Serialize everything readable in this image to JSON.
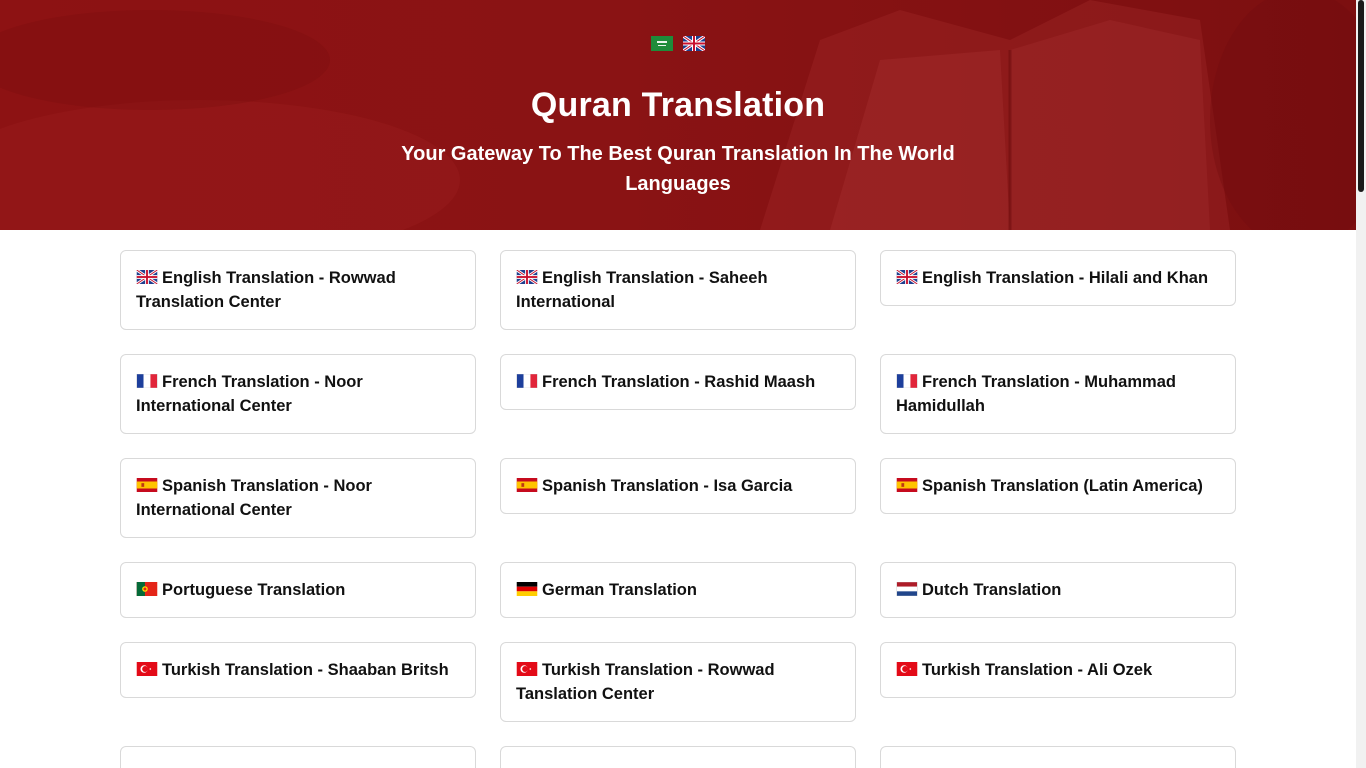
{
  "hero": {
    "title": "Quran Translation",
    "subtitle": "Your Gateway To The Best Quran Translation In The World Languages",
    "languages": [
      {
        "icon": "saudi-flag-icon",
        "code": "ar"
      },
      {
        "icon": "uk-flag-icon",
        "code": "en"
      }
    ],
    "colors": {
      "background": "#8a1314",
      "text": "#ffffff"
    }
  },
  "translations": [
    {
      "label": "English Translation - Rowwad Translation Center",
      "flag": "uk-flag-icon"
    },
    {
      "label": "English Translation - Saheeh International",
      "flag": "uk-flag-icon"
    },
    {
      "label": "English Translation - Hilali and Khan",
      "flag": "uk-flag-icon"
    },
    {
      "label": "French Translation - Noor International Center",
      "flag": "france-flag-icon"
    },
    {
      "label": "French Translation - Rashid Maash",
      "flag": "france-flag-icon"
    },
    {
      "label": "French Translation - Muhammad Hamidullah",
      "flag": "france-flag-icon"
    },
    {
      "label": "Spanish Translation - Noor International Center",
      "flag": "spain-flag-icon"
    },
    {
      "label": "Spanish Translation - Isa Garcia",
      "flag": "spain-flag-icon"
    },
    {
      "label": "Spanish Translation (Latin America)",
      "flag": "spain-flag-icon"
    },
    {
      "label": "Portuguese Translation",
      "flag": "portugal-flag-icon"
    },
    {
      "label": "German Translation",
      "flag": "germany-flag-icon"
    },
    {
      "label": "Dutch Translation",
      "flag": "netherlands-flag-icon"
    },
    {
      "label": "Turkish Translation - Shaaban Britsh",
      "flag": "turkey-flag-icon"
    },
    {
      "label": "Turkish Translation - Rowwad Tanslation Center",
      "flag": "turkey-flag-icon"
    },
    {
      "label": "Turkish Translation - Ali Ozek",
      "flag": "turkey-flag-icon"
    }
  ]
}
